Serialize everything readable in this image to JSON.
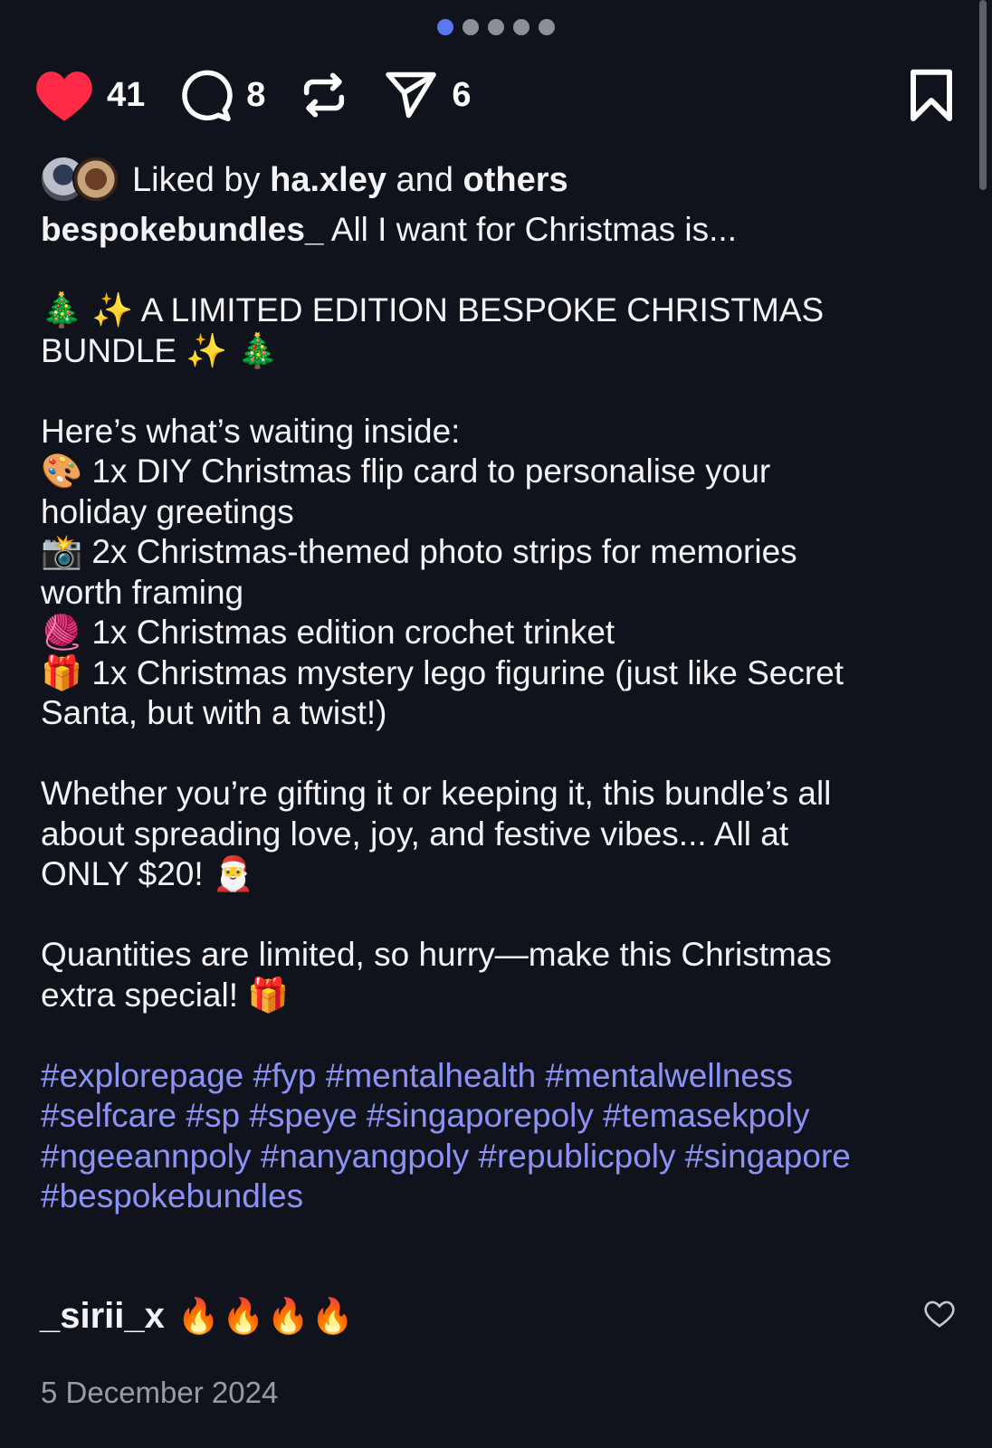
{
  "carousel": {
    "count": 5,
    "active_index": 0,
    "active_color": "#5b78f0"
  },
  "actions": {
    "like_count": "41",
    "comment_count": "8",
    "share_count": "6",
    "like_color": "#ff2a45"
  },
  "likes": {
    "prefix": "Liked by",
    "user": "ha.xley",
    "connector": "and",
    "others": "others"
  },
  "caption": {
    "username": "bespokebundles_",
    "line1": " All I want for Christmas is...",
    "body": "\n\n🎄 ✨ A LIMITED EDITION BESPOKE CHRISTMAS\nBUNDLE ✨ 🎄\n\nHere’s what’s waiting inside:\n🎨 1x DIY Christmas flip card to personalise your\nholiday greetings\n📸 2x Christmas-themed photo strips for memories\nworth framing\n🧶 1x Christmas edition crochet trinket\n🎁 1x Christmas mystery lego figurine (just like Secret\nSanta, but with a twist!)\n\nWhether you’re gifting it or keeping it, this bundle’s all\nabout spreading love, joy, and festive vibes... All at\nONLY $20! 🎅\n\nQuantities are limited, so hurry—make this Christmas\nextra special! 🎁\n\n",
    "hashtags": "#explorepage #fyp #mentalhealth #mentalwellness\n#selfcare #sp #speye #singaporepoly #temasekpoly\n#ngeeannpoly #nanyangpoly #republicpoly #singapore\n#bespokebundles",
    "hashtag_color": "#8c93f5"
  },
  "comment": {
    "username": "_sirii_x",
    "text": "🔥🔥🔥🔥"
  },
  "date": "5 December 2024"
}
